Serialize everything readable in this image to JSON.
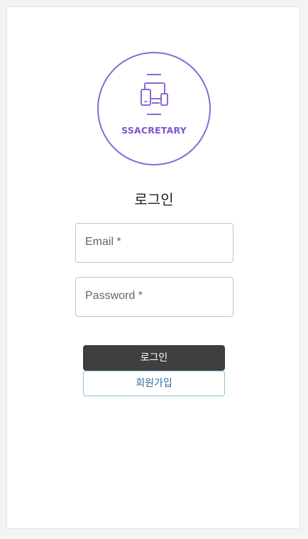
{
  "logo": {
    "text": "SSACRETARY",
    "icon": "devices-icon",
    "accent_color": "#8c67d6"
  },
  "login_form": {
    "title": "로그인",
    "email_label": "Email *",
    "password_label": "Password *",
    "login_button": "로그인",
    "signup_button": "회원가입"
  },
  "colors": {
    "login_button_bg": "#3f3f3f",
    "signup_button_border": "#8cc0dd",
    "signup_button_text": "#2c6fa0"
  }
}
